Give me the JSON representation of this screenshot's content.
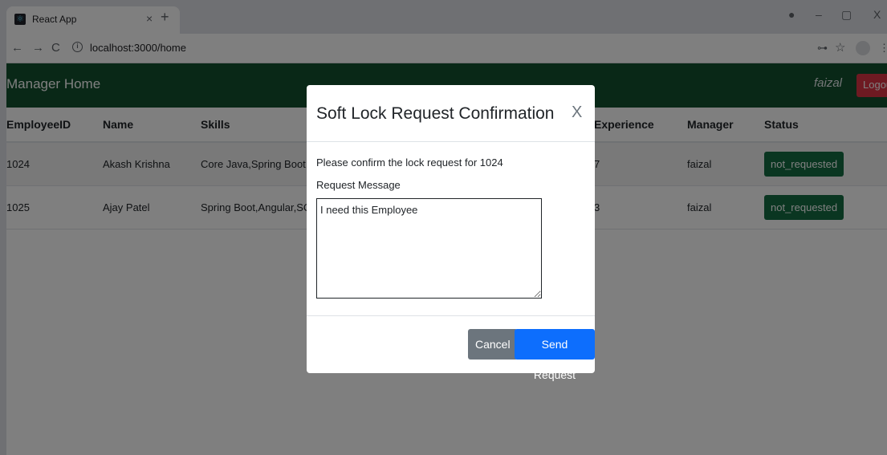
{
  "browser": {
    "tab_title": "React App",
    "tab_close": "×",
    "new_tab": "+",
    "url": "localhost:3000/home",
    "info": "i",
    "nav": {
      "back": "←",
      "forward": "→",
      "reload": "C"
    },
    "window": {
      "minimize": "–",
      "maximize": "▢",
      "close": "X"
    },
    "icons": {
      "key": "⊶",
      "star": "☆",
      "menu": "⋮",
      "location": "●"
    }
  },
  "app": {
    "brand": "Manager Home",
    "username": "faizal",
    "logout_label": "Logout",
    "table": {
      "headers": [
        "EmployeeID",
        "Name",
        "Skills",
        "Experience",
        "Manager",
        "Status"
      ],
      "rows": [
        {
          "id": "1024",
          "name": "Akash Krishna",
          "skills": "Core Java,Spring Boot,",
          "experience": "7",
          "manager": "faizal",
          "status": "not_requested"
        },
        {
          "id": "1025",
          "name": "Ajay Patel",
          "skills": "Spring Boot,Angular,SC",
          "experience": "3",
          "manager": "faizal",
          "status": "not_requested"
        }
      ]
    }
  },
  "modal": {
    "title": "Soft Lock Request Confirmation",
    "close": "X",
    "confirm_text": "Please confirm the lock request for 1024",
    "message_label": "Request Message",
    "message_value": "I need this Employee",
    "cancel_label": "Cancel",
    "send_label": "Send Request"
  },
  "colors": {
    "navbar": "#12512e",
    "status_button": "#146c43",
    "logout": "#dc3545",
    "primary": "#0d6efd",
    "secondary": "#6c757d"
  }
}
